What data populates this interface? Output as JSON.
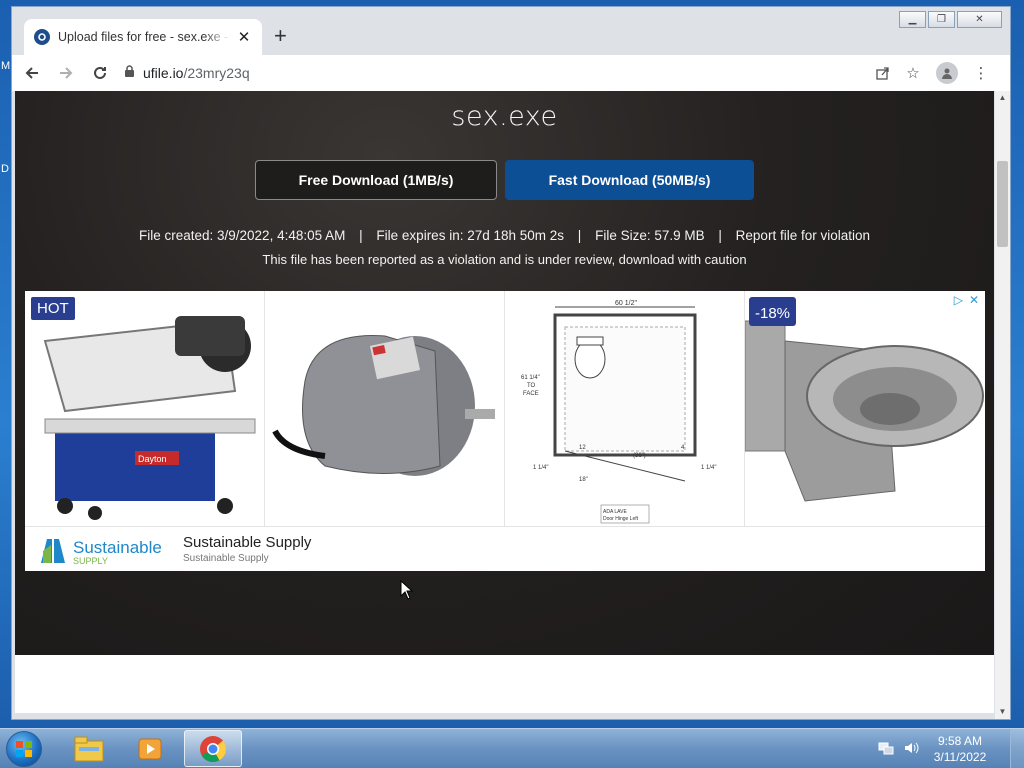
{
  "desktop": {
    "char_1": "M",
    "char_2": "D"
  },
  "browser": {
    "tab": {
      "title": "Upload files for free - sex.exe - ufile.io"
    },
    "toolbar": {
      "url_domain": "ufile.io",
      "url_path": "/23mry23q"
    }
  },
  "page": {
    "file_name": "sex.exe",
    "free_download_label": "Free Download (1MB/s)",
    "fast_download_label": "Fast Download (50MB/s)",
    "meta": {
      "created": "File created: 3/9/2022, 4:48:05 AM",
      "expires": "File expires in: 27d 18h 50m 2s",
      "size": "File Size: 57.9 MB",
      "report": "Report file for violation",
      "separator": "|"
    },
    "warning": "This file has been reported as a violation and is under review, download with caution",
    "ad": {
      "hot_badge": "HOT",
      "discount_badge": "-18%",
      "brand_name": "Sustainable Supply",
      "brand_sub": "Sustainable Supply",
      "logo_text_main": "Sustainable",
      "logo_text_sub": "SUPPLY",
      "adchoices_play": "▷",
      "adchoices_close": "✕",
      "diagram": {
        "width_label": "60 1/2\"",
        "height_label": "61 1/4\"",
        "height_label_2": "TO",
        "height_label_3": "FACE",
        "bottom_left": "1 1/4\"",
        "bottom_right": "1 1/4\"",
        "bottom_mid": "18\"",
        "door_label": "ADA LAVE",
        "door_label_2": "Door Hinge Left",
        "small_1": "12",
        "small_2": "4",
        "small_3": "(36\")"
      },
      "bandsaw_brand": "Dayton"
    }
  },
  "taskbar": {
    "clock_time": "9:58 AM",
    "clock_date": "3/11/2022"
  },
  "colors": {
    "fast_button": "#0d4f94",
    "hero_bg": "#242120",
    "badge": "#2a3e8f"
  }
}
